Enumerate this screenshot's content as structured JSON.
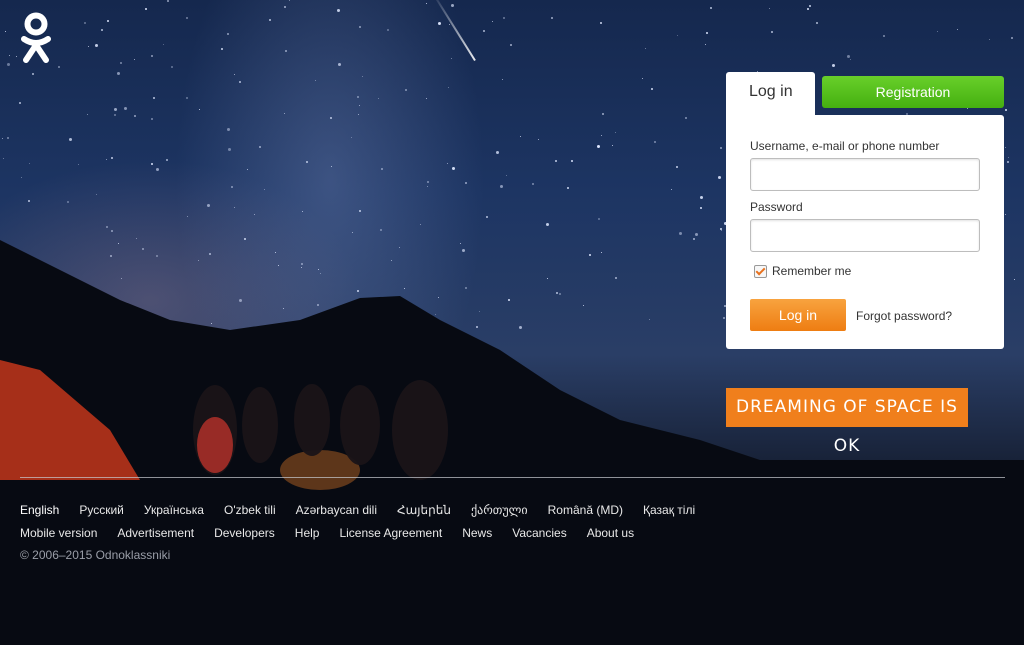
{
  "login_tab": {
    "label": "Log in"
  },
  "registration_tab": {
    "label": "Registration"
  },
  "form": {
    "username_label": "Username, e-mail or phone number",
    "username_value": "",
    "password_label": "Password",
    "password_value": "",
    "remember_label": "Remember me",
    "remember_checked": true,
    "submit_label": "Log in",
    "forgot_label": "Forgot password?"
  },
  "promo": {
    "text": "DREAMING OF SPACE IS OK"
  },
  "footer": {
    "languages": [
      "English",
      "Русский",
      "Українська",
      "O'zbek tili",
      "Azərbaycan dili",
      "Հայերեն",
      "ქართული",
      "Română (MD)",
      "Қазақ тілі"
    ],
    "active_language": "English",
    "links": [
      "Mobile version",
      "Advertisement",
      "Developers",
      "Help",
      "License Agreement",
      "News",
      "Vacancies",
      "About us"
    ],
    "copyright": "© 2006–2015 Odnoklassniki"
  },
  "colors": {
    "brand_orange": "#ee8208",
    "registration_green": "#4ab615",
    "login_orange": "#f08a1e"
  },
  "icons": {
    "logo": "ok-logo-icon"
  }
}
